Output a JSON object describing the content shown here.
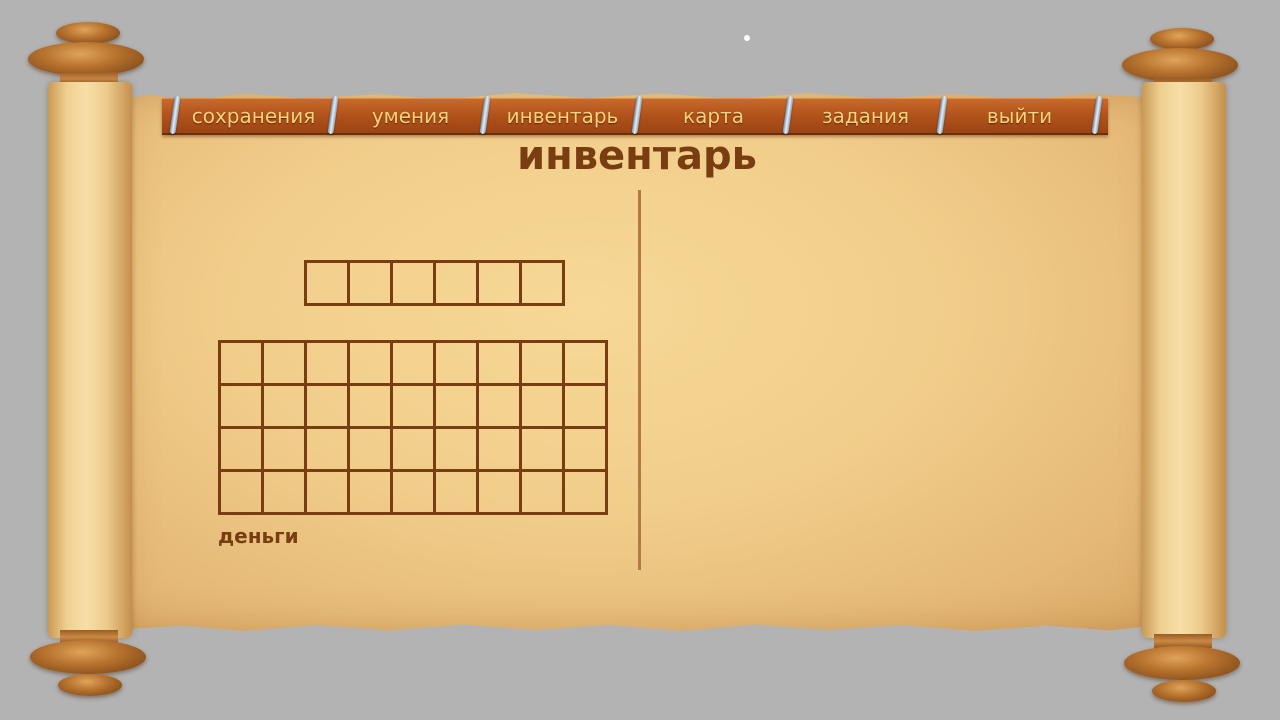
{
  "menu": {
    "items": [
      {
        "id": "saves",
        "label": "сохранения"
      },
      {
        "id": "skills",
        "label": "умения"
      },
      {
        "id": "inventory",
        "label": "инвентарь"
      },
      {
        "id": "map",
        "label": "карта"
      },
      {
        "id": "quests",
        "label": "задания"
      },
      {
        "id": "exit",
        "label": "выйти"
      }
    ]
  },
  "page": {
    "title": "инвентарь"
  },
  "inventory": {
    "equipment_slots": {
      "columns": 6,
      "rows": 1
    },
    "bag_slots": {
      "columns": 9,
      "rows": 4
    },
    "money_label": "деньги"
  },
  "colors": {
    "background": "#b3b3b3",
    "parchment": "#f1cd8a",
    "menu_bar": "#b2541c",
    "menu_text": "#f6d27a",
    "ink": "#7a3d12",
    "divider": "#b27a45"
  }
}
